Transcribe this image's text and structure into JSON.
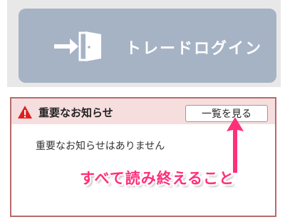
{
  "login": {
    "label": "トレードログイン",
    "icon": "door-enter-icon",
    "bg_color": "#a6b3c4"
  },
  "notice": {
    "icon": "warning-icon",
    "title": "重要なお知らせ",
    "view_all_label": "一覧を見る",
    "empty_message": "重要なお知らせはありません",
    "border_color": "#b86a6a",
    "header_color": "#f6dede"
  },
  "annotation": {
    "text": "すべて読み終えること",
    "color": "#ff2f7a",
    "arrow_icon": "arrow-up-icon"
  }
}
